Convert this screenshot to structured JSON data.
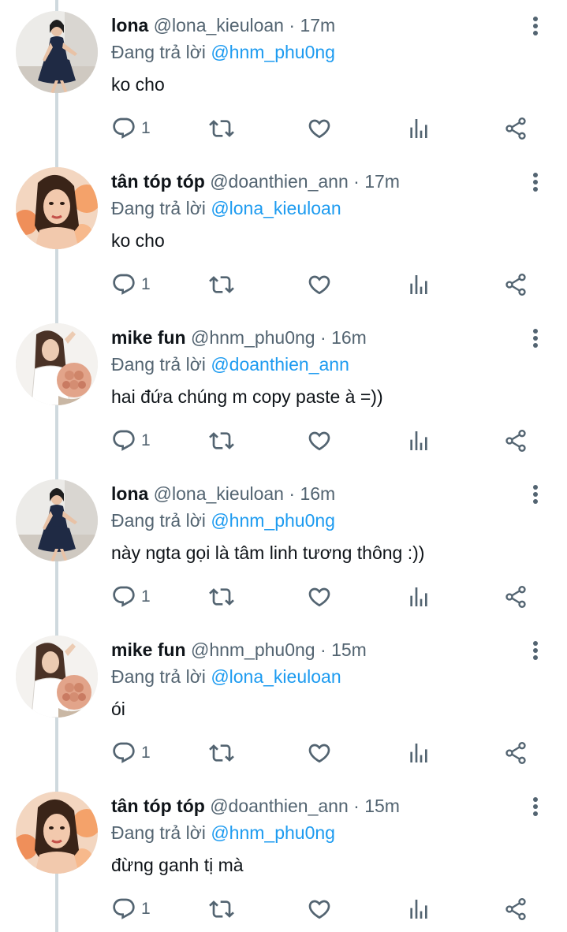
{
  "reply_prefix": "Đang trả lời",
  "tweets": [
    {
      "name": "lona",
      "handle": "@lona_kieuloan",
      "sep": "·",
      "time": "17m",
      "mention": "@hnm_phu0ng",
      "text": "ko cho",
      "replies": "1",
      "avatar": "lona"
    },
    {
      "name": "tân tóp tóp",
      "handle": "@doanthien_ann",
      "sep": "·",
      "time": "17m",
      "mention": "@lona_kieuloan",
      "text": "ko cho",
      "replies": "1",
      "avatar": "tan"
    },
    {
      "name": "mike fun",
      "handle": "@hnm_phu0ng",
      "sep": "·",
      "time": "16m",
      "mention": "@doanthien_ann",
      "text": "hai đứa chúng m copy paste à =))",
      "replies": "1",
      "avatar": "mike"
    },
    {
      "name": "lona",
      "handle": "@lona_kieuloan",
      "sep": "·",
      "time": "16m",
      "mention": "@hnm_phu0ng",
      "text": "này ngta gọi là tâm linh tương thông :))",
      "replies": "1",
      "avatar": "lona"
    },
    {
      "name": "mike fun",
      "handle": "@hnm_phu0ng",
      "sep": "·",
      "time": "15m",
      "mention": "@lona_kieuloan",
      "text": "ói",
      "replies": "1",
      "avatar": "mike"
    },
    {
      "name": "tân tóp tóp",
      "handle": "@doanthien_ann",
      "sep": "·",
      "time": "15m",
      "mention": "@hnm_phu0ng",
      "text": "đừng ganh tị mà",
      "replies": "1",
      "avatar": "tan"
    }
  ],
  "icons": {
    "reply": "reply-icon",
    "retweet": "retweet-icon",
    "like": "heart-icon",
    "views": "views-icon",
    "share": "share-icon",
    "more": "more-vertical-icon"
  },
  "colors": {
    "name": "#0f1419",
    "secondary": "#536471",
    "mention": "#1d9bf0",
    "thread_line": "#cfd9de"
  }
}
